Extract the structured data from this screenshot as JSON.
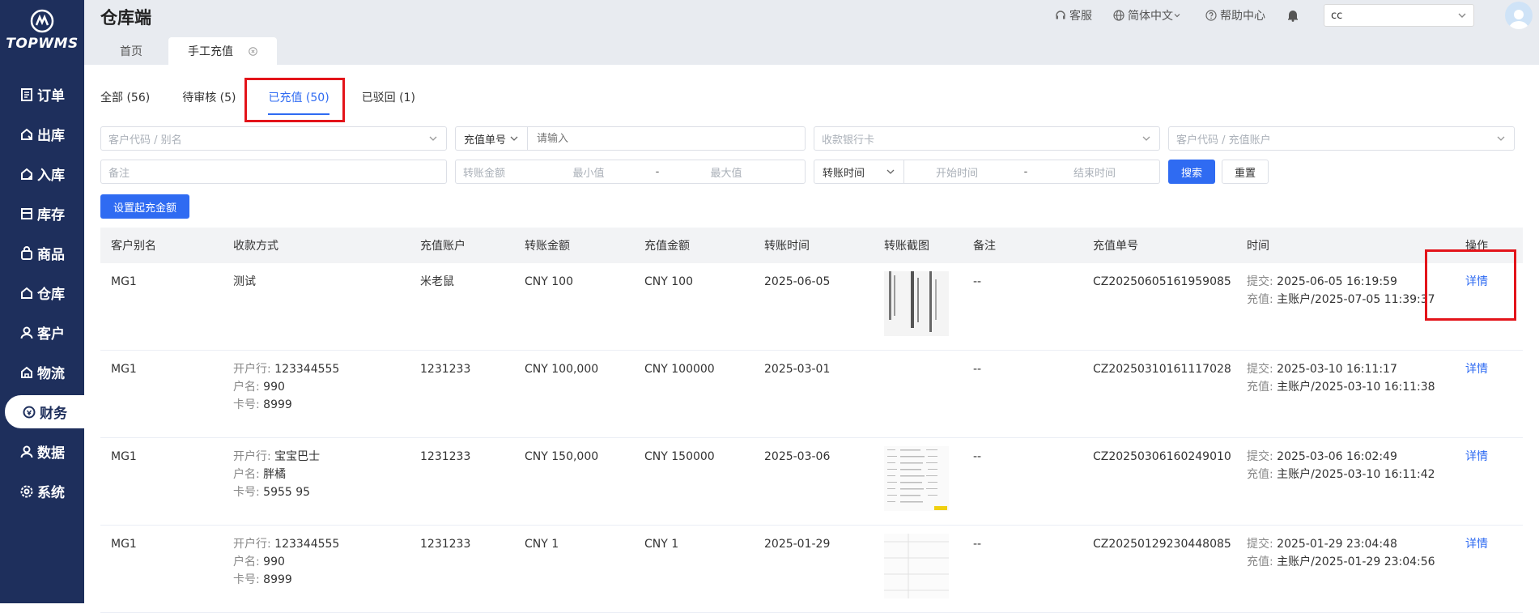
{
  "app": {
    "logo_text": "TOPWMS",
    "title": "仓库端"
  },
  "sidebar": {
    "items": [
      {
        "label": "订单",
        "icon": "order-icon"
      },
      {
        "label": "出库",
        "icon": "outbound-icon"
      },
      {
        "label": "入库",
        "icon": "inbound-icon"
      },
      {
        "label": "库存",
        "icon": "inventory-icon"
      },
      {
        "label": "商品",
        "icon": "product-icon"
      },
      {
        "label": "仓库",
        "icon": "warehouse-icon"
      },
      {
        "label": "客户",
        "icon": "customer-icon"
      },
      {
        "label": "物流",
        "icon": "logistics-icon"
      },
      {
        "label": "财务",
        "icon": "finance-icon"
      },
      {
        "label": "数据",
        "icon": "data-icon"
      },
      {
        "label": "系统",
        "icon": "system-icon"
      }
    ]
  },
  "header": {
    "service": "客服",
    "language": "简体中文",
    "help": "帮助中心",
    "warehouse_value": "cc"
  },
  "page_tabs": [
    {
      "label": "首页"
    },
    {
      "label": "手工充值"
    }
  ],
  "status_tabs": [
    {
      "label": "全部 (56)"
    },
    {
      "label": "待审核 (5)"
    },
    {
      "label": "已充值 (50)"
    },
    {
      "label": "已驳回 (1)"
    }
  ],
  "filters": {
    "customer_code_placeholder": "客户代码 / 别名",
    "order_type_value": "充值单号",
    "order_input_placeholder": "请输入",
    "bank_card_placeholder": "收款银行卡",
    "customer_account_placeholder": "客户代码 / 充值账户",
    "remark_placeholder": "备注",
    "amount_label": "转账金额",
    "min_placeholder": "最小值",
    "range_sep": "-",
    "max_placeholder": "最大值",
    "time_type_value": "转账时间",
    "start_placeholder": "开始时间",
    "end_placeholder": "结束时间",
    "search_label": "搜索",
    "reset_label": "重置",
    "set_min_label": "设置起充金额"
  },
  "table": {
    "headers": {
      "alias": "客户别名",
      "method": "收款方式",
      "account": "充值账户",
      "transfer_amount": "转账金额",
      "recharge_amount": "充值金额",
      "transfer_time": "转账时间",
      "screenshot": "转账截图",
      "remark": "备注",
      "order_no": "充值单号",
      "time": "时间",
      "action": "操作"
    },
    "labels": {
      "bank": "开户行:",
      "holder": "户名:",
      "card": "卡号:",
      "submit": "提交:",
      "recharge": "充值:",
      "detail": "详情"
    },
    "rows": [
      {
        "alias": "MG1",
        "method": "测试",
        "bank": "",
        "holder": "",
        "card": "",
        "account": "米老鼠",
        "transfer_amount": "CNY 100",
        "recharge_amount": "CNY 100",
        "transfer_time": "2025-06-05",
        "remark": "--",
        "order_no": "CZ20250605161959085",
        "submit_time": "2025-06-05 16:19:59",
        "recharge_time": "主账户/2025-07-05 11:39:37"
      },
      {
        "alias": "MG1",
        "method": "",
        "bank": "123344555",
        "holder": "990",
        "card": "8999",
        "account": "1231233",
        "transfer_amount": "CNY 100,000",
        "recharge_amount": "CNY 100000",
        "transfer_time": "2025-03-01",
        "remark": "--",
        "order_no": "CZ20250310161117028",
        "submit_time": "2025-03-10 16:11:17",
        "recharge_time": "主账户/2025-03-10 16:11:38"
      },
      {
        "alias": "MG1",
        "method": "",
        "bank": "宝宝巴士",
        "holder": "胖橘",
        "card": "5955 95",
        "account": "1231233",
        "transfer_amount": "CNY 150,000",
        "recharge_amount": "CNY 150000",
        "transfer_time": "2025-03-06",
        "remark": "--",
        "order_no": "CZ20250306160249010",
        "submit_time": "2025-03-06 16:02:49",
        "recharge_time": "主账户/2025-03-10 16:11:42"
      },
      {
        "alias": "MG1",
        "method": "",
        "bank": "123344555",
        "holder": "990",
        "card": "8999",
        "account": "1231233",
        "transfer_amount": "CNY 1",
        "recharge_amount": "CNY 1",
        "transfer_time": "2025-01-29",
        "remark": "--",
        "order_no": "CZ20250129230448085",
        "submit_time": "2025-01-29 23:04:48",
        "recharge_time": "主账户/2025-01-29 23:04:56"
      }
    ]
  },
  "colors": {
    "sidebar": "#1e2f5c",
    "primary": "#2f6bf2",
    "highlight": "#e3141a"
  }
}
